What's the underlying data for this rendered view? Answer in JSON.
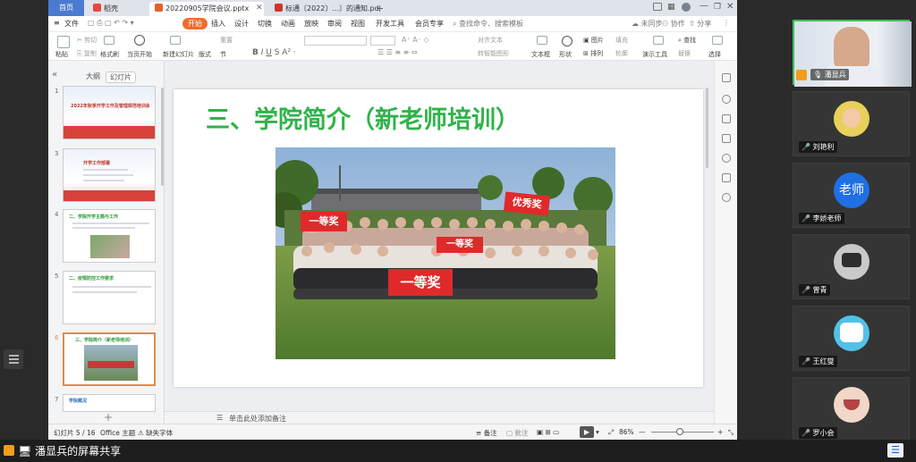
{
  "window": {
    "tabs": [
      {
        "label": "首页"
      },
      {
        "label": "稻壳"
      },
      {
        "label": "20220905学院会议.pptx"
      },
      {
        "label": "标通〔2022〕...〕的通知.pdf"
      }
    ],
    "top_right": {
      "sync": "未同步",
      "collab": "协作",
      "share": "分享"
    }
  },
  "menubar": {
    "file": "文件",
    "items": [
      "开始",
      "插入",
      "设计",
      "切换",
      "动画",
      "放映",
      "审阅",
      "视图",
      "开发工具",
      "会员专享"
    ],
    "search_placeholder": "查找命令、搜索模板"
  },
  "toolbar": {
    "paste": "粘贴",
    "cut": "剪切",
    "copy": "复制",
    "format_painter": "格式刷",
    "from_current": "当页开始",
    "new_slide": "新建幻灯片",
    "layout": "版式",
    "section": "节",
    "reset": "重置",
    "text_box": "文本框",
    "shape": "形状",
    "arrange": "排列",
    "picture": "图片",
    "fill": "填充",
    "outline": "轮廓",
    "presenter_tools": "演示工具",
    "find": "查找",
    "replace": "替换",
    "select": "选择",
    "align_text": "对齐文本",
    "smartart": "转智能图形"
  },
  "left_panel": {
    "tabs": [
      "大纲",
      "幻灯片"
    ],
    "thumbs": [
      {
        "num": "1",
        "title": "2022年秋季开学工作及管理规范培训会"
      },
      {
        "num": "3",
        "title": "开学工作部署"
      },
      {
        "num": "4",
        "title": "二、学院开学主题与工作"
      },
      {
        "num": "5",
        "title": "二、疫情防控工作要求"
      },
      {
        "num": "6",
        "title": "三、学院简介（新老师培训）"
      },
      {
        "num": "7",
        "title": "学院概况"
      }
    ]
  },
  "slide": {
    "title": "三、学院简介（新老师培训）",
    "photo_banners": [
      "一等奖",
      "一等奖",
      "一等奖",
      "优秀奖"
    ]
  },
  "notes": {
    "placeholder": "单击此处添加备注"
  },
  "statusbar": {
    "slide_info": "幻灯片 5 / 16",
    "theme": "Office 主题",
    "missing_font": "缺失字体",
    "notes_btn": "备注",
    "comments_btn": "批注",
    "zoom": "86%"
  },
  "participants": [
    {
      "name": "潘显兵",
      "video": true
    },
    {
      "name": "刘艳利",
      "avatar_color": "#e8d05a"
    },
    {
      "name": "李娇老师",
      "avatar_color": "#1f6fe5",
      "avatar_text": "老师"
    },
    {
      "name": "曾青",
      "avatar_color": "#c9c9c9"
    },
    {
      "name": "王红燮",
      "avatar_color": "#52c1e8"
    },
    {
      "name": "罗小会",
      "avatar_color": "#f1d7c7"
    }
  ],
  "bottom": {
    "share_label": "潘显兵的屏幕共享"
  },
  "colors": {
    "accent": "#f26b2c",
    "title_green": "#2fb34a",
    "tab_blue": "#4a7bd0"
  }
}
